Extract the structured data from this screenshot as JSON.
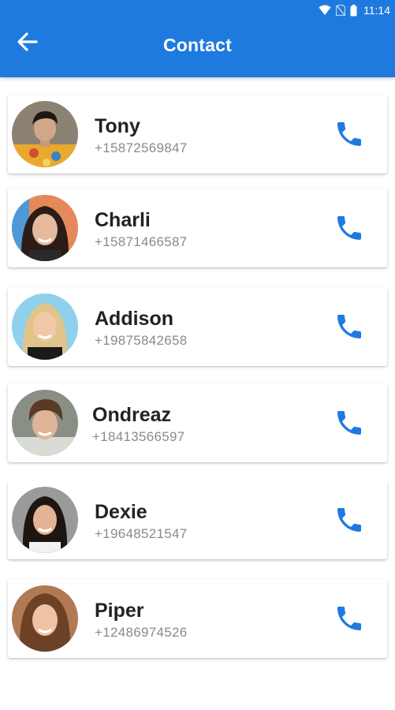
{
  "status_bar": {
    "time": "11:14",
    "icons": [
      "wifi-icon",
      "no-sim-icon",
      "battery-icon"
    ]
  },
  "header": {
    "title": "Contact",
    "back_icon": "arrow-left-icon"
  },
  "colors": {
    "primary": "#1f7ae0",
    "name_text": "#222222",
    "phone_text": "#8a8a8a",
    "call_icon": "#1f7ae0"
  },
  "contacts": [
    {
      "name": "Tony",
      "phone": "+15872569847",
      "call_icon": "phone-icon"
    },
    {
      "name": "Charli",
      "phone": "+15871466587",
      "call_icon": "phone-icon"
    },
    {
      "name": "Addison",
      "phone": "+19875842658",
      "call_icon": "phone-icon"
    },
    {
      "name": "Ondreaz",
      "phone": "+18413566597",
      "call_icon": "phone-icon"
    },
    {
      "name": "Dexie",
      "phone": "+19648521547",
      "call_icon": "phone-icon"
    },
    {
      "name": "Piper",
      "phone": "+12486974526",
      "call_icon": "phone-icon"
    }
  ]
}
